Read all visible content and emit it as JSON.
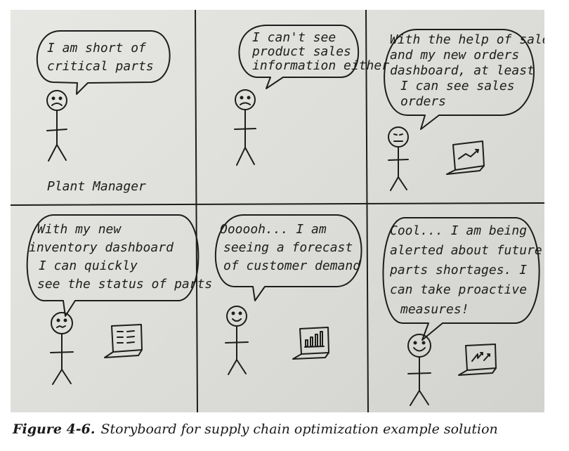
{
  "panels": [
    {
      "speech": [
        "I am short of",
        "critical parts"
      ],
      "label": "Plant Manager"
    },
    {
      "speech": [
        "I can't see",
        "product sales",
        "information either"
      ]
    },
    {
      "speech": [
        "With the help of sales",
        "and my new orders",
        "dashboard, at least",
        "I can see sales",
        "orders"
      ]
    },
    {
      "speech": [
        "With my new",
        "inventory dashboard",
        "I can quickly",
        "see the status of parts"
      ]
    },
    {
      "speech": [
        "Oooooh... I am",
        "seeing a forecast",
        "of customer demand"
      ]
    },
    {
      "speech": [
        "Cool... I am being",
        "alerted about future",
        "parts shortages. I",
        "can take proactive",
        "measures!"
      ]
    }
  ],
  "caption": {
    "label": "Figure 4-6.",
    "text": "Storyboard for supply chain optimization example solution"
  }
}
